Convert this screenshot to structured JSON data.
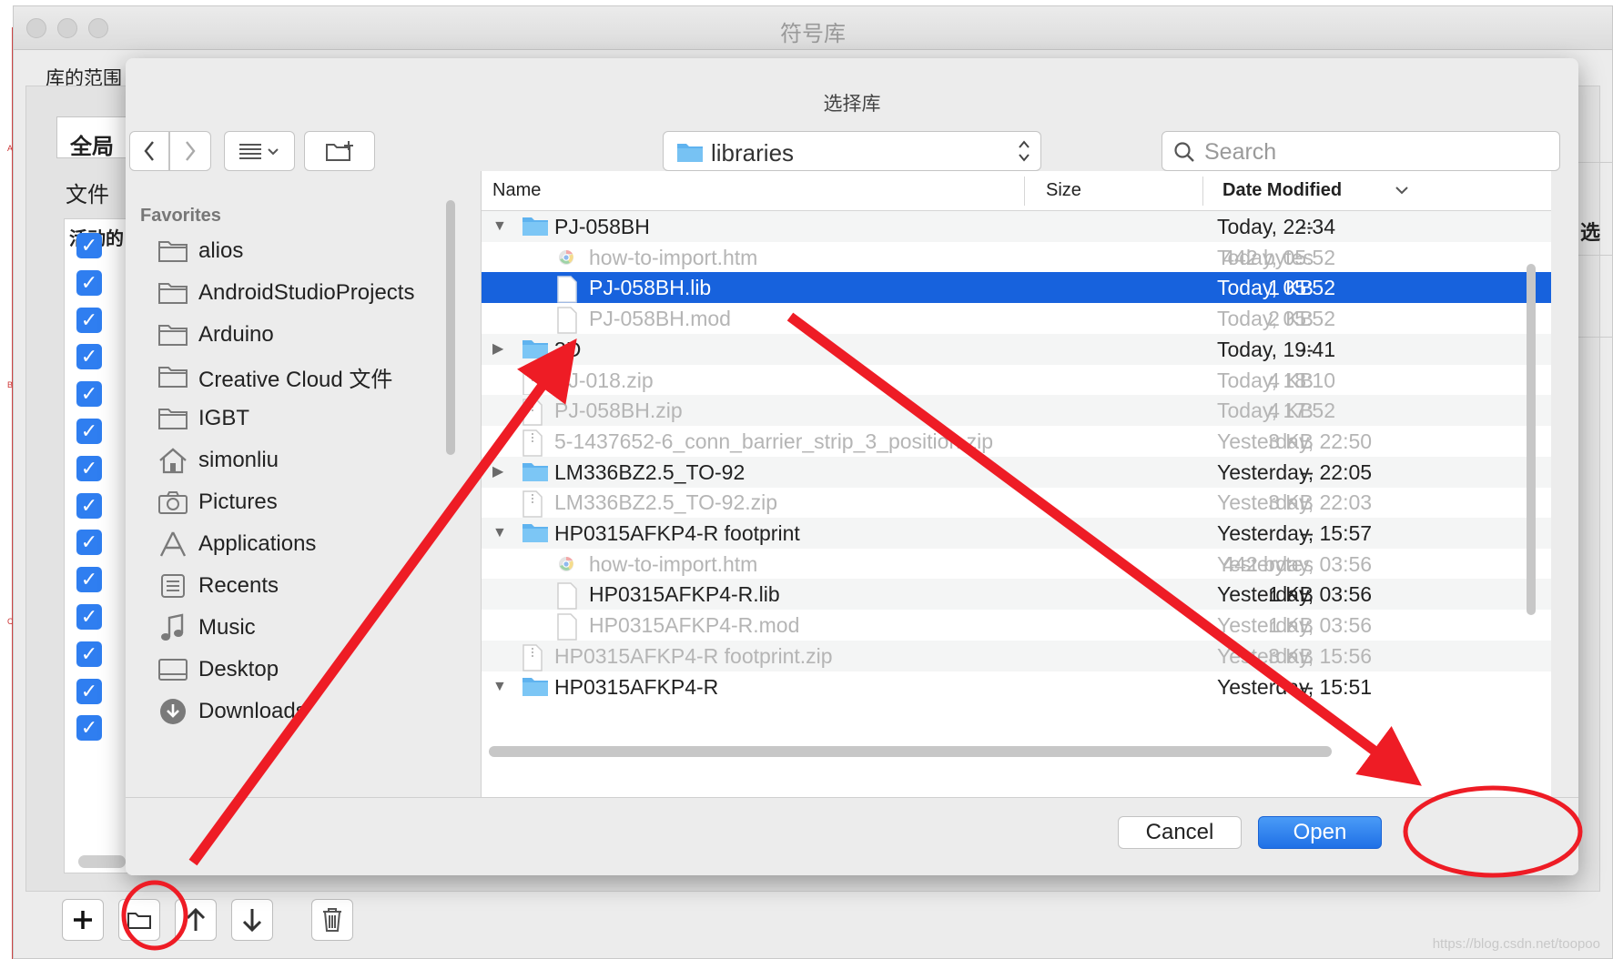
{
  "background_window": {
    "title": "符号库",
    "scope_label": "库的范围",
    "tab_label": "全局",
    "files_label": "文件",
    "active_header": "活动的",
    "right_header": "选",
    "left_marks": [
      "A",
      "B",
      "C"
    ],
    "watermark": "https://blog.csdn.net/toopoo"
  },
  "dialog": {
    "title": "选择库",
    "location": "libraries",
    "search_placeholder": "Search",
    "sidebar": {
      "heading": "Favorites",
      "items": [
        {
          "label": "alios",
          "icon": "folder-icon"
        },
        {
          "label": "AndroidStudioProjects",
          "icon": "folder-icon"
        },
        {
          "label": "Arduino",
          "icon": "folder-icon"
        },
        {
          "label": "Creative Cloud 文件",
          "icon": "folder-icon"
        },
        {
          "label": "IGBT",
          "icon": "folder-icon"
        },
        {
          "label": "simonliu",
          "icon": "home-icon"
        },
        {
          "label": "Pictures",
          "icon": "camera-icon"
        },
        {
          "label": "Applications",
          "icon": "applications-icon"
        },
        {
          "label": "Recents",
          "icon": "recents-icon"
        },
        {
          "label": "Music",
          "icon": "music-icon"
        },
        {
          "label": "Desktop",
          "icon": "desktop-icon"
        },
        {
          "label": "Downloads",
          "icon": "downloads-icon"
        }
      ]
    },
    "columns": {
      "name": "Name",
      "size": "Size",
      "date": "Date Modified"
    },
    "files": [
      {
        "name": "PJ-058BH",
        "size": "--",
        "date": "Today, 22:34",
        "kind": "folder",
        "level": 0,
        "disclosure": "open",
        "dim": false
      },
      {
        "name": "how-to-import.htm",
        "size": "442 bytes",
        "date": "Today, 05:52",
        "kind": "html",
        "level": 1,
        "disclosure": "",
        "dim": true
      },
      {
        "name": "PJ-058BH.lib",
        "size": "1 KB",
        "date": "Today, 05:52",
        "kind": "doc",
        "level": 1,
        "disclosure": "",
        "dim": false,
        "selected": true
      },
      {
        "name": "PJ-058BH.mod",
        "size": "2 KB",
        "date": "Today, 05:52",
        "kind": "doc",
        "level": 1,
        "disclosure": "",
        "dim": true
      },
      {
        "name": "3D",
        "size": "--",
        "date": "Today, 19:41",
        "kind": "folder",
        "level": 0,
        "disclosure": "closed",
        "dim": false
      },
      {
        "name": "PJ-018.zip",
        "size": "4 KB",
        "date": "Today, 18:10",
        "kind": "zip",
        "level": 0,
        "disclosure": "",
        "dim": true
      },
      {
        "name": "PJ-058BH.zip",
        "size": "4 KB",
        "date": "Today, 17:52",
        "kind": "zip",
        "level": 0,
        "disclosure": "",
        "dim": true
      },
      {
        "name": "5-1437652-6_conn_barrier_strip_3_position.zip",
        "size": "3 KB",
        "date": "Yesterday, 22:50",
        "kind": "zip",
        "level": 0,
        "disclosure": "",
        "dim": true
      },
      {
        "name": "LM336BZ2.5_TO-92",
        "size": "--",
        "date": "Yesterday, 22:05",
        "kind": "folder",
        "level": 0,
        "disclosure": "closed",
        "dim": false
      },
      {
        "name": "LM336BZ2.5_TO-92.zip",
        "size": "3 KB",
        "date": "Yesterday, 22:03",
        "kind": "zip",
        "level": 0,
        "disclosure": "",
        "dim": true
      },
      {
        "name": "HP0315AFKP4-R footprint",
        "size": "--",
        "date": "Yesterday, 15:57",
        "kind": "folder",
        "level": 0,
        "disclosure": "open",
        "dim": false
      },
      {
        "name": "how-to-import.htm",
        "size": "442 bytes",
        "date": "Yesterday, 03:56",
        "kind": "html",
        "level": 1,
        "disclosure": "",
        "dim": true
      },
      {
        "name": "HP0315AFKP4-R.lib",
        "size": "1 KB",
        "date": "Yesterday, 03:56",
        "kind": "doc",
        "level": 1,
        "disclosure": "",
        "dim": false
      },
      {
        "name": "HP0315AFKP4-R.mod",
        "size": "1 KB",
        "date": "Yesterday, 03:56",
        "kind": "doc",
        "level": 1,
        "disclosure": "",
        "dim": true
      },
      {
        "name": "HP0315AFKP4-R footprint.zip",
        "size": "3 KB",
        "date": "Yesterday, 15:56",
        "kind": "zip",
        "level": 0,
        "disclosure": "",
        "dim": true
      },
      {
        "name": "HP0315AFKP4-R",
        "size": "--",
        "date": "Yesterday, 15:51",
        "kind": "folder",
        "level": 0,
        "disclosure": "open",
        "dim": false
      }
    ],
    "cancel_label": "Cancel",
    "open_label": "Open"
  },
  "colors": {
    "selection": "#1762dd",
    "open_button": "#1f70e6",
    "annotation": "#ee1c25",
    "folder": "#5fb3ef"
  }
}
